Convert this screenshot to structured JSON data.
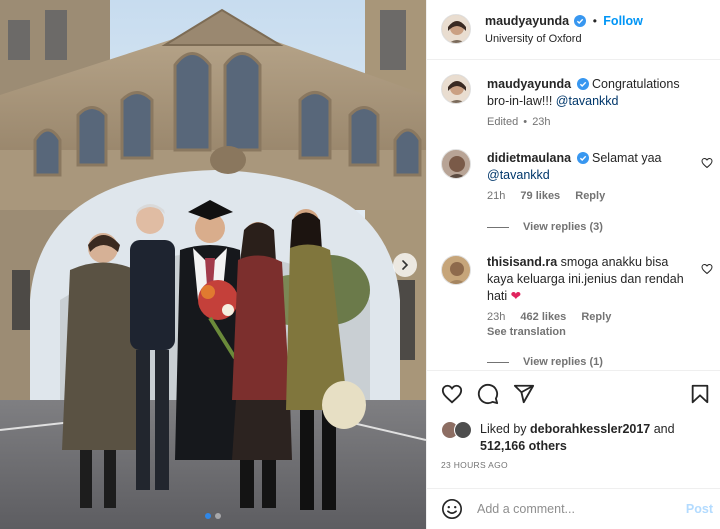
{
  "post": {
    "author": "maudyayunda",
    "follow_label": "Follow",
    "location": "University of Oxford",
    "separator": "•",
    "photo_icons": {
      "next": "chevron-right-icon"
    }
  },
  "caption": {
    "username": "maudyayunda",
    "text": "Congratulations bro-in-law!!! ",
    "mention": "@tavankkd",
    "edited": "Edited",
    "time": "23h"
  },
  "comments": [
    {
      "username": "didietmaulana",
      "text": "Selamat yaa ",
      "mention": "@tavankkd",
      "time": "21h",
      "likes": "79 likes",
      "reply_label": "Reply",
      "view_replies": "View replies (3)"
    },
    {
      "username": "thisisand.ra",
      "text": "smoga anakku bisa kaya keluarga ini.jenius dan rendah hati",
      "emoji": "❤",
      "time": "23h",
      "likes": "462 likes",
      "reply_label": "Reply",
      "see_translation": "See translation",
      "view_replies": "View replies (1)"
    }
  ],
  "actions": {
    "icons": [
      "heart-icon",
      "comment-icon",
      "share-icon",
      "bookmark-icon"
    ],
    "liked_prefix": "Liked by ",
    "liked_user": "deborahkessler2017",
    "liked_and": " and",
    "liked_count": "512,166 others",
    "timestamp": "23 HOURS AGO"
  },
  "add_comment": {
    "placeholder": "Add a comment...",
    "post_label": "Post",
    "icon": "emoji-icon"
  },
  "colors": {
    "accent": "#0095f6",
    "verified": "#3897f0",
    "post_disabled": "#b3dbff",
    "meta": "#737373",
    "heart_emoji": "#e0245e"
  }
}
